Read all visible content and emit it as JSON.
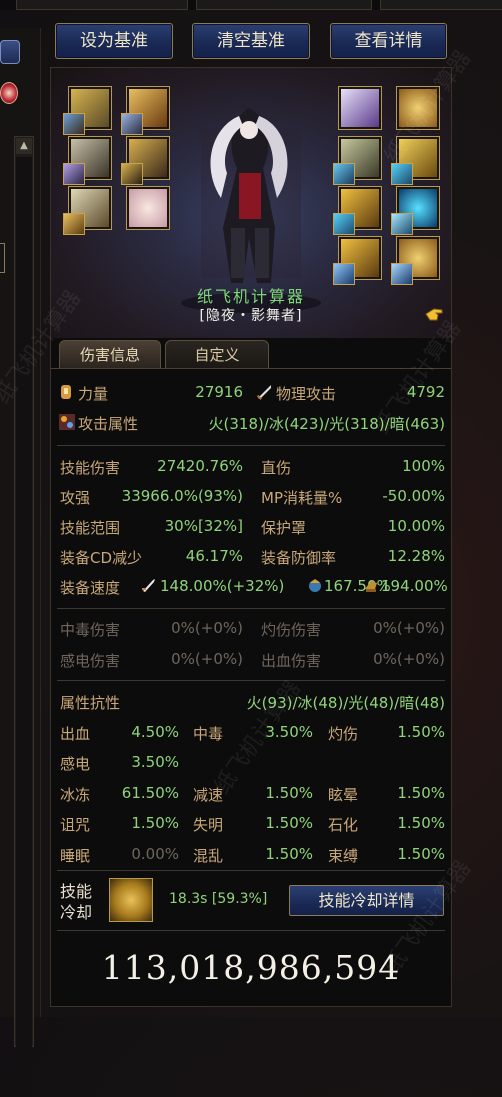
{
  "header": {
    "set_baseline": "设为基准",
    "clear_baseline": "清空基准",
    "view_details": "查看详情"
  },
  "character": {
    "name": "纸飞机计算器",
    "class": "[隐夜・影舞者]"
  },
  "tabs": [
    {
      "label": "伤害信息",
      "active": true
    },
    {
      "label": "自定义",
      "active": false
    }
  ],
  "stats_basic": {
    "strength_label": "力量",
    "strength_value": "27916",
    "phys_attack_label": "物理攻击",
    "phys_attack_value": "4792",
    "element_label": "攻击属性",
    "element_value": "火(318)/冰(423)/光(318)/暗(463)"
  },
  "stats_damage": {
    "skill_damage_label": "技能伤害",
    "skill_damage_value": "27420.76%",
    "direct_label": "直伤",
    "direct_value": "100%",
    "attack_power_label": "攻强",
    "attack_power_value": "33966.0%(93%)",
    "mp_cost_label": "MP消耗量%",
    "mp_cost_value": "-50.00%",
    "skill_range_label": "技能范围",
    "skill_range_value": "30%[32%]",
    "shield_label": "保护罩",
    "shield_value": "10.00%",
    "cd_reduce_label": "装备CD减少",
    "cd_reduce_value": "46.17%",
    "equip_def_label": "装备防御率",
    "equip_def_value": "12.28%",
    "equip_speed_label": "装备速度",
    "attack_speed_value": "148.00%(+32%)",
    "cast_speed_value": "167.50%",
    "move_speed_value": "194.00%"
  },
  "stats_dot": {
    "poison_label": "中毒伤害",
    "poison_value": "0%(+0%)",
    "burn_label": "灼伤伤害",
    "burn_value": "0%(+0%)",
    "shock_label": "感电伤害",
    "shock_value": "0%(+0%)",
    "bleed_label": "出血伤害",
    "bleed_value": "0%(+0%)"
  },
  "resistance": {
    "label": "属性抗性",
    "value": "火(93)/冰(48)/光(48)/暗(48)",
    "rows": [
      [
        {
          "label": "出血",
          "value": "4.50%"
        },
        {
          "label": "中毒",
          "value": "3.50%"
        },
        {
          "label": "灼伤",
          "value": "1.50%"
        }
      ],
      [
        {
          "label": "感电",
          "value": "3.50%"
        }
      ],
      [
        {
          "label": "冰冻",
          "value": "61.50%"
        },
        {
          "label": "减速",
          "value": "1.50%"
        },
        {
          "label": "眩晕",
          "value": "1.50%"
        }
      ],
      [
        {
          "label": "诅咒",
          "value": "1.50%"
        },
        {
          "label": "失明",
          "value": "1.50%"
        },
        {
          "label": "石化",
          "value": "1.50%"
        }
      ],
      [
        {
          "label": "睡眠",
          "value": "0.00%"
        },
        {
          "label": "混乱",
          "value": "1.50%"
        },
        {
          "label": "束缚",
          "value": "1.50%"
        }
      ]
    ]
  },
  "cooldown": {
    "label_line1": "技能",
    "label_line2": "冷却",
    "value": "18.3s [59.3%]",
    "details_button": "技能冷却详情"
  },
  "total_damage": "113,018,986,594",
  "watermark": "纸飞机计算器"
}
